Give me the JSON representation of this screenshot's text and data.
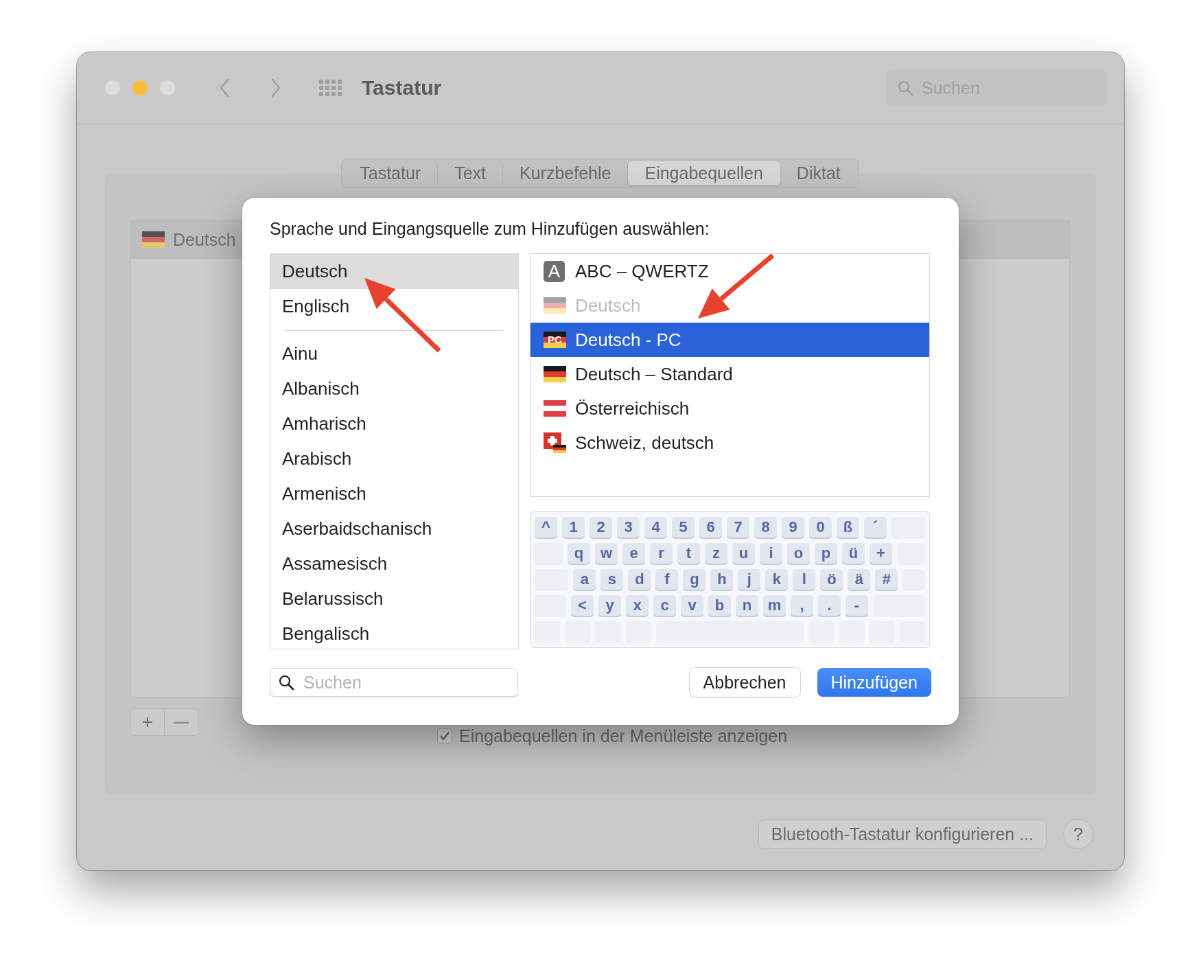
{
  "window": {
    "title": "Tastatur",
    "search": {
      "placeholder": "Suchen"
    }
  },
  "traffic_lights": [
    {
      "color": "#dcdcdc"
    },
    {
      "color": "#f6bd3c"
    },
    {
      "color": "#dcdcdc"
    }
  ],
  "tabs": [
    {
      "label": "Tastatur",
      "selected": false
    },
    {
      "label": "Text",
      "selected": false
    },
    {
      "label": "Kurzbefehle",
      "selected": false
    },
    {
      "label": "Eingabequellen",
      "selected": true
    },
    {
      "label": "Diktat",
      "selected": false
    }
  ],
  "input_sources": [
    {
      "label": "Deutsch",
      "selected": true
    }
  ],
  "list_buttons": [
    {
      "label": "+",
      "disabled": false
    },
    {
      "label": "—",
      "disabled": true
    }
  ],
  "show_in_menu_bar": {
    "label": "Eingabequellen in der Menüleiste anzeigen",
    "checked": true
  },
  "bluetooth_button": "Bluetooth-Tastatur konfigurieren ...",
  "help_button": "?",
  "dialog": {
    "prompt": "Sprache und Eingangsquelle zum Hinzufügen auswählen:",
    "preferred_languages": [
      {
        "label": "Deutsch",
        "selected": true
      },
      {
        "label": "Englisch",
        "selected": false
      }
    ],
    "languages": [
      {
        "label": "Ainu",
        "selected": false
      },
      {
        "label": "Albanisch",
        "selected": false
      },
      {
        "label": "Amharisch",
        "selected": false
      },
      {
        "label": "Arabisch",
        "selected": false
      },
      {
        "label": "Armenisch",
        "selected": false
      },
      {
        "label": "Aserbaidschanisch",
        "selected": false
      },
      {
        "label": "Assamesisch",
        "selected": false
      },
      {
        "label": "Belarussisch",
        "selected": false
      },
      {
        "label": "Bengalisch",
        "selected": false
      }
    ],
    "sources": [
      {
        "label": "ABC – QWERTZ",
        "kind": "letter",
        "badge": "A",
        "selected": false,
        "disabled": false
      },
      {
        "label": "Deutsch",
        "kind": "flag",
        "selected": false,
        "disabled": true
      },
      {
        "label": "Deutsch - PC",
        "kind": "badge",
        "badge": "PC",
        "selected": true,
        "disabled": false
      },
      {
        "label": "Deutsch – Standard",
        "kind": "flag",
        "selected": false,
        "disabled": false
      },
      {
        "label": "Österreichisch",
        "kind": "stripes",
        "selected": false,
        "disabled": false
      },
      {
        "label": "Schweiz, deutsch",
        "kind": "cross",
        "selected": false,
        "disabled": false
      }
    ],
    "keyboard": {
      "rows": [
        {
          "keys": [
            {
              "kind": "key",
              "label": "^"
            },
            {
              "kind": "key",
              "label": "1"
            },
            {
              "kind": "key",
              "label": "2"
            },
            {
              "kind": "key",
              "label": "3"
            },
            {
              "kind": "key",
              "label": "4"
            },
            {
              "kind": "key",
              "label": "5"
            },
            {
              "kind": "key",
              "label": "6"
            },
            {
              "kind": "key",
              "label": "7"
            },
            {
              "kind": "key",
              "label": "8"
            },
            {
              "kind": "key",
              "label": "9"
            },
            {
              "kind": "key",
              "label": "0"
            },
            {
              "kind": "key",
              "label": "ß"
            },
            {
              "kind": "key",
              "label": "´"
            },
            {
              "kind": "blank"
            }
          ]
        },
        {
          "keys": [
            {
              "kind": "blank"
            },
            {
              "kind": "key",
              "label": "q"
            },
            {
              "kind": "key",
              "label": "w"
            },
            {
              "kind": "key",
              "label": "e"
            },
            {
              "kind": "key",
              "label": "r"
            },
            {
              "kind": "key",
              "label": "t"
            },
            {
              "kind": "key",
              "label": "z"
            },
            {
              "kind": "key",
              "label": "u"
            },
            {
              "kind": "key",
              "label": "i"
            },
            {
              "kind": "key",
              "label": "o"
            },
            {
              "kind": "key",
              "label": "p"
            },
            {
              "kind": "key",
              "label": "ü"
            },
            {
              "kind": "key",
              "label": "+"
            },
            {
              "kind": "blank"
            }
          ]
        },
        {
          "keys": [
            {
              "kind": "wide"
            },
            {
              "kind": "key",
              "label": "a"
            },
            {
              "kind": "key",
              "label": "s"
            },
            {
              "kind": "key",
              "label": "d"
            },
            {
              "kind": "key",
              "label": "f"
            },
            {
              "kind": "key",
              "label": "g"
            },
            {
              "kind": "key",
              "label": "h"
            },
            {
              "kind": "key",
              "label": "j"
            },
            {
              "kind": "key",
              "label": "k"
            },
            {
              "kind": "key",
              "label": "l"
            },
            {
              "kind": "key",
              "label": "ö"
            },
            {
              "kind": "key",
              "label": "ä"
            },
            {
              "kind": "key",
              "label": "#"
            },
            {
              "kind": "blank"
            }
          ]
        },
        {
          "keys": [
            {
              "kind": "blank"
            },
            {
              "kind": "key",
              "label": "<"
            },
            {
              "kind": "key",
              "label": "y"
            },
            {
              "kind": "key",
              "label": "x"
            },
            {
              "kind": "key",
              "label": "c"
            },
            {
              "kind": "key",
              "label": "v"
            },
            {
              "kind": "key",
              "label": "b"
            },
            {
              "kind": "key",
              "label": "n"
            },
            {
              "kind": "key",
              "label": "m"
            },
            {
              "kind": "key",
              "label": ","
            },
            {
              "kind": "key",
              "label": "."
            },
            {
              "kind": "key",
              "label": "-"
            },
            {
              "kind": "wide"
            }
          ]
        },
        {
          "keys": [
            {
              "kind": "blank"
            },
            {
              "kind": "blank"
            },
            {
              "kind": "blank"
            },
            {
              "kind": "blank"
            },
            {
              "kind": "space"
            },
            {
              "kind": "blank"
            },
            {
              "kind": "blank"
            },
            {
              "kind": "blank"
            },
            {
              "kind": "blank"
            }
          ]
        }
      ]
    },
    "search": {
      "placeholder": "Suchen"
    },
    "buttons": [
      {
        "label": "Abbrechen",
        "kind": "cancel"
      },
      {
        "label": "Hinzufügen",
        "kind": "default"
      }
    ]
  }
}
